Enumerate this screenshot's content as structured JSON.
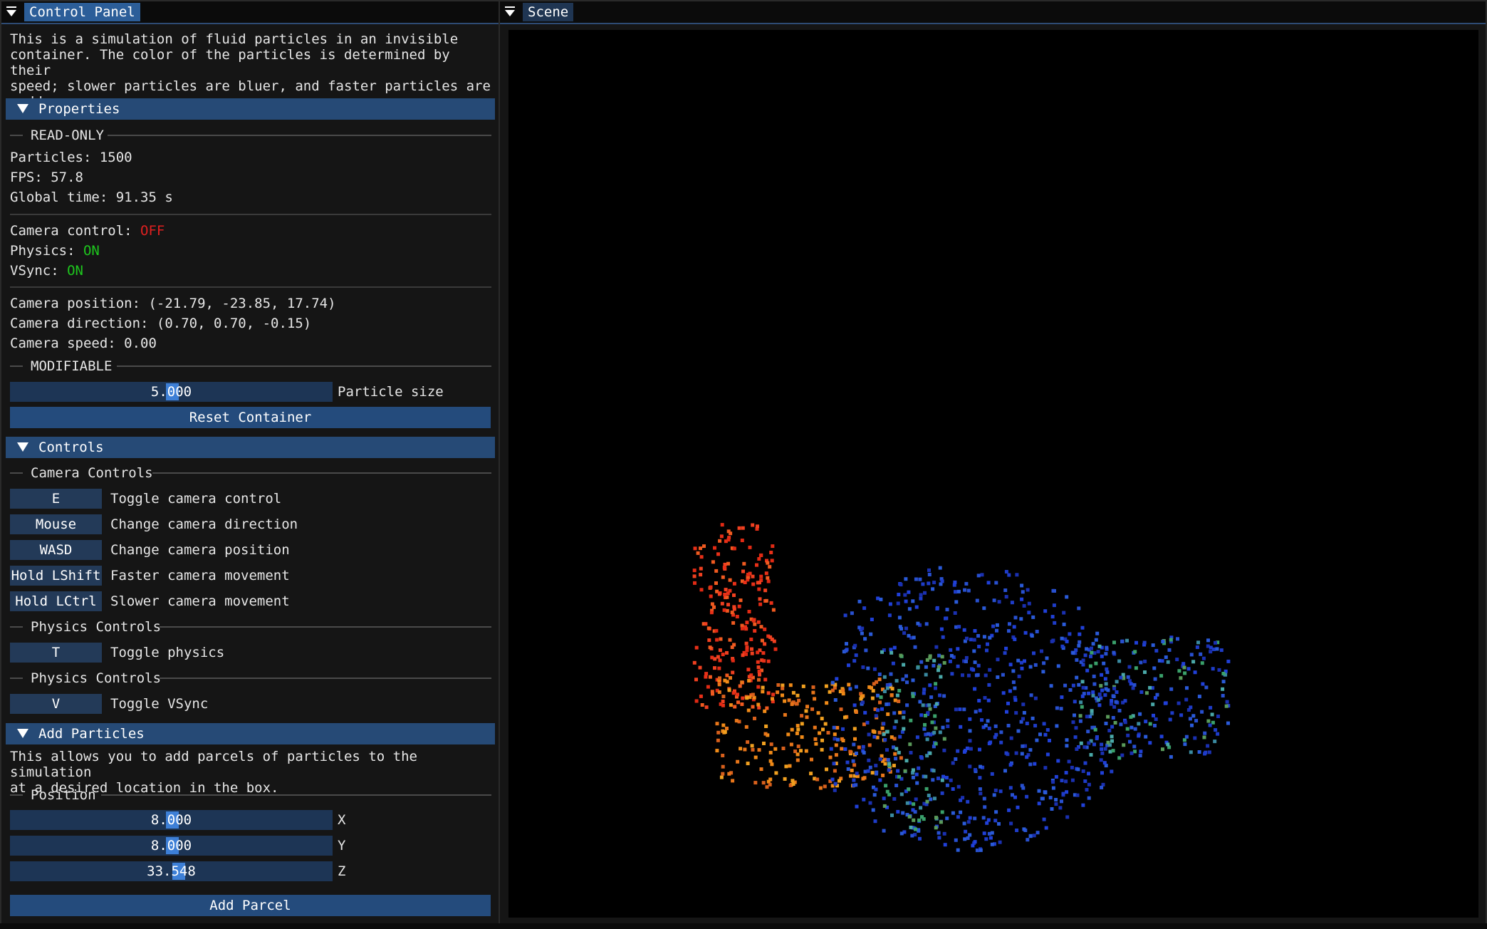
{
  "control_panel": {
    "title": "Control Panel",
    "description": "This is a simulation of fluid particles in an invisible\ncontainer. The color of the particles is determined by their\nspeed; slower particles are bluer, and faster particles are\nredder.",
    "properties": {
      "header": "Properties",
      "readonly_label": "READ-ONLY",
      "particles": "Particles: 1500",
      "fps": "FPS: 57.8",
      "global_time": "Global time: 91.35 s",
      "camera_control_label": "Camera control: ",
      "camera_control_value": "OFF",
      "physics_label": "Physics: ",
      "physics_value": "ON",
      "vsync_label": "VSync: ",
      "vsync_value": "ON",
      "camera_position": "Camera position: (-21.79, -23.85, 17.74)",
      "camera_direction": "Camera direction: (0.70, 0.70, -0.15)",
      "camera_speed": "Camera speed: 0.00",
      "modifiable_label": "MODIFIABLE",
      "particle_size_value": "5.000",
      "particle_size_label": "Particle size",
      "reset_button": "Reset Container"
    },
    "controls": {
      "header": "Controls",
      "camera_section": "Camera Controls",
      "camera_keys": [
        {
          "key": "E",
          "desc": "Toggle camera control"
        },
        {
          "key": "Mouse",
          "desc": "Change camera direction"
        },
        {
          "key": "WASD",
          "desc": "Change camera position"
        },
        {
          "key": "Hold LShift",
          "desc": "Faster camera movement"
        },
        {
          "key": "Hold LCtrl",
          "desc": "Slower camera movement"
        }
      ],
      "physics_section": "Physics Controls",
      "physics_key": {
        "key": "T",
        "desc": "Toggle physics"
      },
      "physics_section_2": "Physics Controls",
      "vsync_key": {
        "key": "V",
        "desc": "Toggle VSync"
      }
    },
    "add_particles": {
      "header": "Add Particles",
      "description": "This allows you to add parcels of particles to the simulation\nat a desired location in the box.",
      "position_label": "Position",
      "x_value": "8.000",
      "x_label": "X",
      "y_value": "8.000",
      "y_label": "Y",
      "z_value": "33.548",
      "z_label": "Z",
      "add_button": "Add Parcel"
    }
  },
  "scene": {
    "title": "Scene",
    "particle_colors": [
      "#1e3cc8",
      "#e83018",
      "#f08a18",
      "#3aa06a"
    ]
  },
  "colors": {
    "accent": "#2c5e99",
    "header_bg": "#264a76",
    "off": "#e02020",
    "on": "#1ec61e"
  }
}
